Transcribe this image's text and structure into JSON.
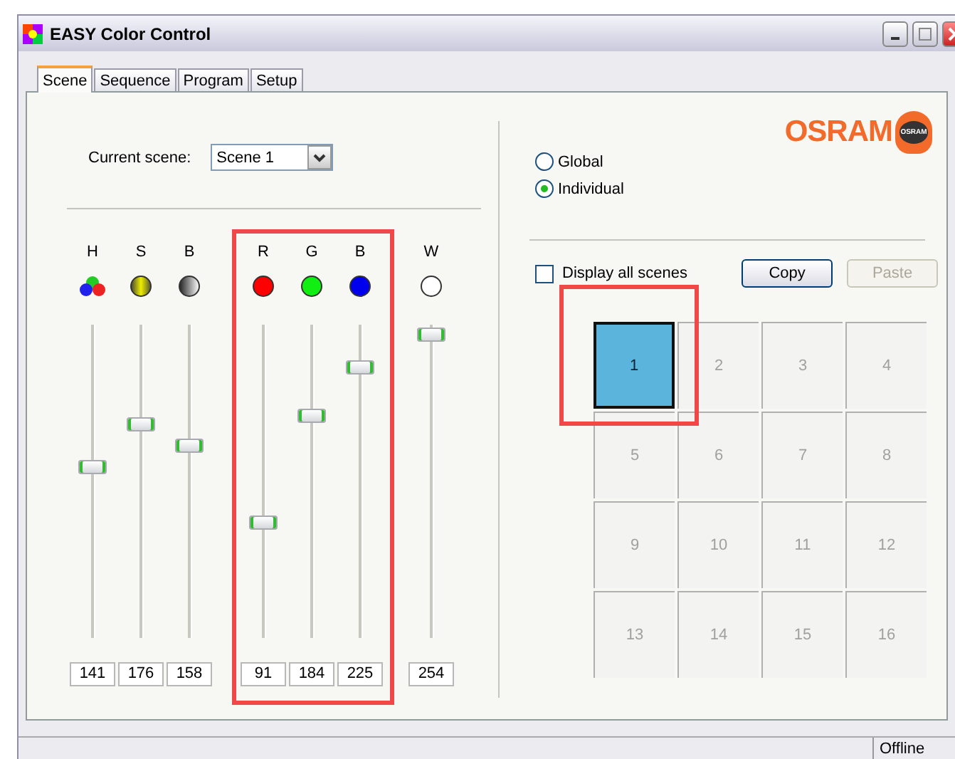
{
  "window": {
    "title": "EASY Color Control"
  },
  "tabs": [
    {
      "label": "Scene",
      "selected": true
    },
    {
      "label": "Sequence",
      "selected": false
    },
    {
      "label": "Program",
      "selected": false
    },
    {
      "label": "Setup",
      "selected": false
    }
  ],
  "current_scene": {
    "label": "Current scene:",
    "value": "Scene 1"
  },
  "slider_groups": [
    {
      "highlighted": false,
      "sliders": [
        {
          "label": "H",
          "kind": "hue",
          "level": 0.55,
          "value": "141"
        },
        {
          "label": "S",
          "kind": "saturation",
          "level": 0.69,
          "value": "176"
        },
        {
          "label": "B",
          "kind": "brightness",
          "level": 0.62,
          "value": "158"
        }
      ]
    },
    {
      "highlighted": true,
      "sliders": [
        {
          "label": "R",
          "kind": "red",
          "level": 0.36,
          "value": "91"
        },
        {
          "label": "G",
          "kind": "green",
          "level": 0.72,
          "value": "184"
        },
        {
          "label": "B",
          "kind": "blue",
          "level": 0.88,
          "value": "225"
        }
      ]
    },
    {
      "highlighted": false,
      "sliders": [
        {
          "label": "W",
          "kind": "white",
          "level": 0.99,
          "value": "254"
        }
      ]
    }
  ],
  "logo": {
    "text": "OSRAM",
    "bulb_text": "OSRAM"
  },
  "mode": [
    {
      "label": "Global",
      "selected": false
    },
    {
      "label": "Individual",
      "selected": true
    }
  ],
  "display_all_scenes": {
    "label": "Display all scenes",
    "checked": false
  },
  "buttons": [
    {
      "label": "Copy",
      "disabled": false
    },
    {
      "label": "Paste",
      "disabled": true
    }
  ],
  "scenes": [
    {
      "label": "1",
      "selected": true,
      "highlighted": true
    },
    {
      "label": "2",
      "selected": false,
      "highlighted": false
    },
    {
      "label": "3",
      "selected": false,
      "highlighted": false
    },
    {
      "label": "4",
      "selected": false,
      "highlighted": false
    },
    {
      "label": "5",
      "selected": false,
      "highlighted": false
    },
    {
      "label": "6",
      "selected": false,
      "highlighted": false
    },
    {
      "label": "7",
      "selected": false,
      "highlighted": false
    },
    {
      "label": "8",
      "selected": false,
      "highlighted": false
    },
    {
      "label": "9",
      "selected": false,
      "highlighted": false
    },
    {
      "label": "10",
      "selected": false,
      "highlighted": false
    },
    {
      "label": "11",
      "selected": false,
      "highlighted": false
    },
    {
      "label": "12",
      "selected": false,
      "highlighted": false
    },
    {
      "label": "13",
      "selected": false,
      "highlighted": false
    },
    {
      "label": "14",
      "selected": false,
      "highlighted": false
    },
    {
      "label": "15",
      "selected": false,
      "highlighted": false
    },
    {
      "label": "16",
      "selected": false,
      "highlighted": false
    }
  ],
  "status_bar": {
    "status": "Offline"
  }
}
